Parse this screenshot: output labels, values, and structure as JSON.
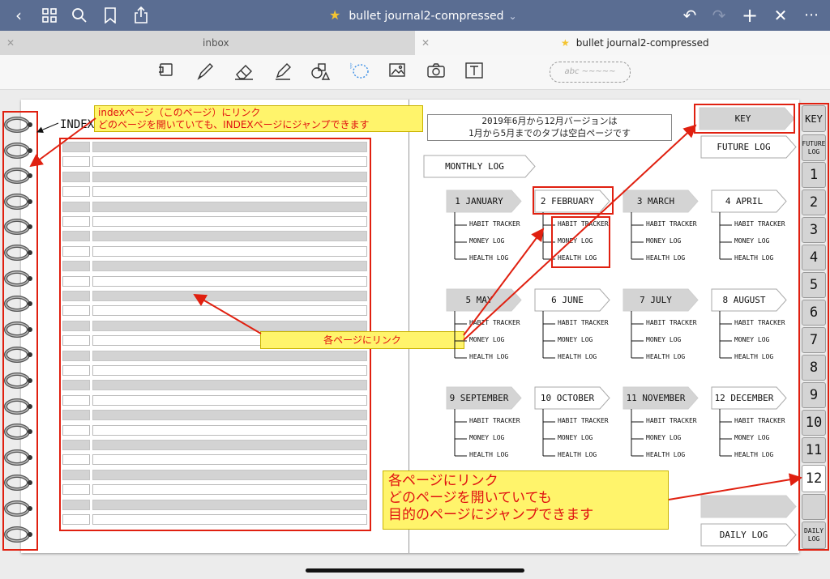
{
  "app": {
    "title": "bullet journal2-compressed",
    "tabs": [
      {
        "label": "inbox",
        "active": false
      },
      {
        "label": "bullet journal2-compressed",
        "active": true
      }
    ],
    "accent_color": "#5a6d92",
    "annotation_color": "#e02010",
    "note_color": "#fff46b"
  },
  "toolbar": {
    "icons": [
      "back-icon",
      "grid-icon",
      "search-icon",
      "bookmark-icon",
      "share-icon",
      "undo-icon",
      "redo-icon",
      "add-icon",
      "close-icon",
      "more-icon"
    ],
    "tools": [
      "reader-icon",
      "pen-icon",
      "eraser-icon",
      "highlighter-icon",
      "shapes-icon",
      "lasso-icon",
      "image-icon",
      "camera-icon",
      "text-icon"
    ],
    "abc_pill": "abc ~~~~~"
  },
  "left_page": {
    "index_label": "INDEX",
    "note_top": [
      "indexページ（このページ）にリンク",
      "どのページを開いていても、INDEXページにジャンプできます"
    ],
    "note_mid": "各ページにリンク",
    "rows": 26
  },
  "right_page": {
    "info_box": [
      "2019年6月から12月バージョンは",
      "1月から5月までのタブは空白ページです"
    ],
    "monthly_log": "MONTHLY LOG",
    "key": "KEY",
    "future_log": "FUTURE LOG",
    "daily_log": "DAILY LOG",
    "months": [
      {
        "label": "1 JANUARY",
        "gray": true
      },
      {
        "label": "2 FEBRUARY",
        "gray": false
      },
      {
        "label": "3 MARCH",
        "gray": true
      },
      {
        "label": "4 APRIL",
        "gray": false
      },
      {
        "label": "5 MAY",
        "gray": true
      },
      {
        "label": "6 JUNE",
        "gray": false
      },
      {
        "label": "7 JULY",
        "gray": true
      },
      {
        "label": "8 AUGUST",
        "gray": false
      },
      {
        "label": "9 SEPTEMBER",
        "gray": true
      },
      {
        "label": "10 OCTOBER",
        "gray": false
      },
      {
        "label": "11 NOVEMBER",
        "gray": true
      },
      {
        "label": "12 DECEMBER",
        "gray": false
      }
    ],
    "sub_items": [
      "HABIT TRACKER",
      "MONEY LOG",
      "HEALTH LOG"
    ],
    "note_big": [
      "各ページにリンク",
      "どのページを開いていても",
      "目的のページにジャンプできます"
    ]
  },
  "side_tabs": [
    "KEY",
    "FUTURE LOG",
    "1",
    "2",
    "3",
    "4",
    "5",
    "6",
    "7",
    "8",
    "9",
    "10",
    "11",
    "12",
    "",
    "DAILY LOG"
  ]
}
